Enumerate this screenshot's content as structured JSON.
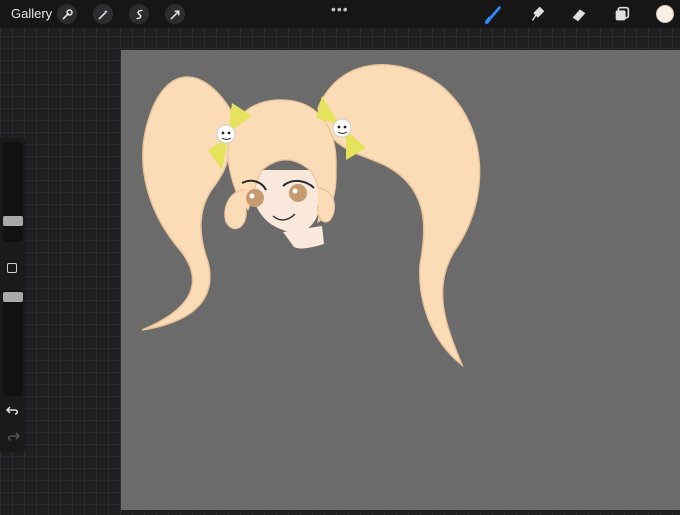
{
  "topbar": {
    "gallery_label": "Gallery",
    "left_tools": [
      {
        "icon": "wrench-icon"
      },
      {
        "icon": "magic-wand-icon"
      },
      {
        "icon": "selection-icon"
      },
      {
        "icon": "transform-arrow-icon"
      }
    ],
    "more_label": "•••",
    "right_tools": [
      {
        "icon": "brush-icon",
        "active": true
      },
      {
        "icon": "smudge-icon"
      },
      {
        "icon": "eraser-icon"
      },
      {
        "icon": "layers-icon"
      }
    ],
    "current_color": "#fbeee4"
  },
  "sidebar": {
    "brush_size": 0.25,
    "opacity": 0.75
  },
  "canvas": {
    "background_color": "#6b6b6b"
  },
  "colors": {
    "accent": "#2f8cff",
    "hair": "#fcdcb6",
    "skin": "#fbe8dd",
    "bow": "#e4e35b",
    "eyes": "#c79a72"
  }
}
